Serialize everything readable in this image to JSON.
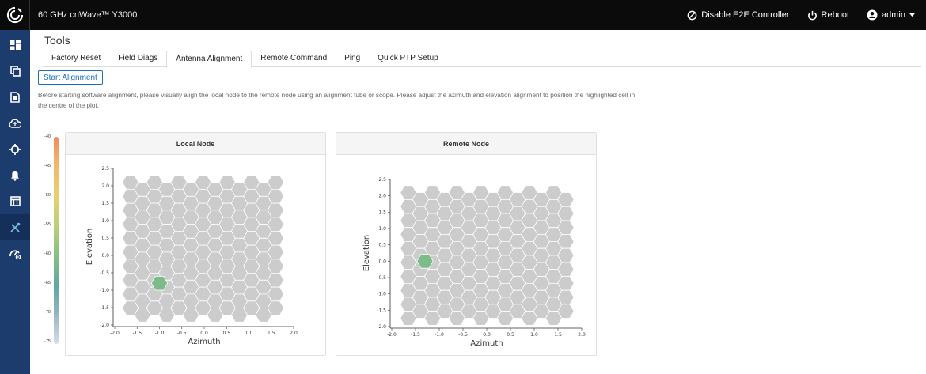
{
  "topbar": {
    "product": "60 GHz cnWave™ Y3000",
    "disable_e2e": "Disable E2E Controller",
    "reboot": "Reboot",
    "user": "admin"
  },
  "sidebar": {
    "items": [
      {
        "icon": "dashboard-icon"
      },
      {
        "icon": "copy-icon"
      },
      {
        "icon": "document-icon"
      },
      {
        "icon": "cloud-upload-icon"
      },
      {
        "icon": "crosshair-icon"
      },
      {
        "icon": "bell-icon"
      },
      {
        "icon": "calendar-icon"
      },
      {
        "icon": "tools-icon"
      },
      {
        "icon": "speed-settings-icon"
      }
    ]
  },
  "page": {
    "title": "Tools",
    "tabs": [
      "Factory Reset",
      "Field Diags",
      "Antenna Alignment",
      "Remote Command",
      "Ping",
      "Quick PTP Setup"
    ],
    "active_tab": "Antenna Alignment",
    "start_button": "Start Alignment",
    "description": "Before starting software alignment, please visually align the local node to the remote node using an alignment tube or scope. Please adjust the azimuth and elevation alignment to position the highlighted cell in the centre of the plot."
  },
  "legend": {
    "ticks": [
      "-40",
      "-45",
      "-50",
      "-55",
      "-60",
      "-65",
      "-70",
      "-75"
    ]
  },
  "colors": {
    "cell": "#cccccc",
    "highlight": "#7dbb8a",
    "sidebar": "#1d3c6e"
  },
  "chart_data": [
    {
      "type": "heatmap",
      "title": "Local Node",
      "xlabel": "Azimuth",
      "ylabel": "Elevation",
      "xlim": [
        -2.0,
        2.0
      ],
      "ylim": [
        -2.0,
        2.5
      ],
      "x_ticks": [
        "-2.0",
        "-1.5",
        "-1.0",
        "-0.5",
        "0.0",
        "0.5",
        "1.0",
        "1.5",
        "2.0"
      ],
      "y_ticks": [
        "2.5",
        "2.0",
        "1.5",
        "1.0",
        "0.5",
        "0.0",
        "-0.5",
        "-1.0",
        "-1.5",
        "-2.0"
      ],
      "highlight": {
        "x": -1.0,
        "y": -0.8
      }
    },
    {
      "type": "heatmap",
      "title": "Remote Node",
      "xlabel": "Azimuth",
      "ylabel": "Elevation",
      "xlim": [
        -2.0,
        2.0
      ],
      "ylim": [
        -2.0,
        2.5
      ],
      "x_ticks": [
        "-2.0",
        "-1.5",
        "-1.0",
        "-0.5",
        "0.0",
        "0.5",
        "1.0",
        "1.5",
        "2.0"
      ],
      "y_ticks": [
        "2.5",
        "2.0",
        "1.5",
        "1.0",
        "0.5",
        "0.0",
        "-0.5",
        "-1.0",
        "-1.5",
        "-2.0"
      ],
      "highlight": {
        "x": -1.3,
        "y": 0.0
      }
    }
  ]
}
